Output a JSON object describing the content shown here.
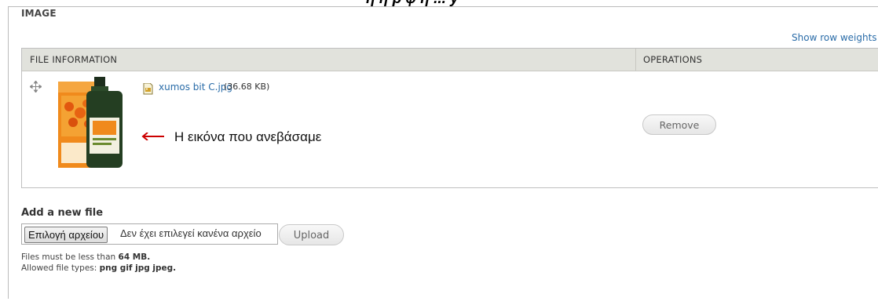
{
  "fieldset": {
    "legend": "IMAGE",
    "row_weights_link": "Show row weights"
  },
  "table": {
    "headers": {
      "file_information": "FILE INFORMATION",
      "operations": "OPERATIONS"
    },
    "row": {
      "file_name": "xumos bit C.jpg",
      "file_size": "(36.68 KB)",
      "remove_label": "Remove",
      "thumbnail_icon": "product-thumbnail",
      "file_type_icon": "image-file-icon",
      "drag_icon": "drag-handle-icon"
    }
  },
  "annotation": {
    "text": "Η εικόνα που ανεβάσαμε",
    "arrow_color": "#cc0000"
  },
  "add_file": {
    "title": "Add a new file",
    "choose_button": "Επιλογή αρχείου",
    "no_file_text": "Δεν έχει επιλεγεί κανένα αρχείο",
    "upload_label": "Upload",
    "size_prefix": "Files must be less than",
    "size_value": "64 MB.",
    "types_prefix": "Allowed file types:",
    "types_value": "png gif jpg jpeg."
  },
  "colors": {
    "link": "#2a6ca8",
    "header_bg": "#e1e2dc",
    "annotation_arrow": "#cc0000"
  }
}
